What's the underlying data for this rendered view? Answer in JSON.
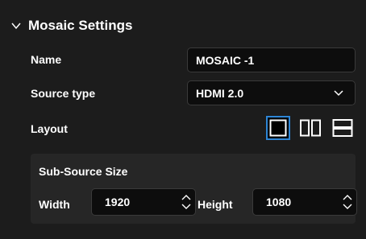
{
  "header": {
    "title": "Mosaic Settings",
    "icon": "chevron-down-icon"
  },
  "name_row": {
    "label": "Name",
    "value": "MOSAIC -1"
  },
  "source_row": {
    "label": "Source type",
    "selected": "HDMI 2.0"
  },
  "layout_row": {
    "label": "Layout",
    "options": [
      "single-layout-icon",
      "side-by-side-layout-icon",
      "stacked-layout-icon"
    ],
    "selected_index": 0
  },
  "sub_source": {
    "title": "Sub-Source Size",
    "width_label": "Width",
    "width_value": "1920",
    "height_label": "Height",
    "height_value": "1080"
  },
  "colors": {
    "background": "#1c1c1c",
    "field_bg": "#0d0d0d",
    "accent": "#2e86d6",
    "subbox_bg": "#262626"
  }
}
